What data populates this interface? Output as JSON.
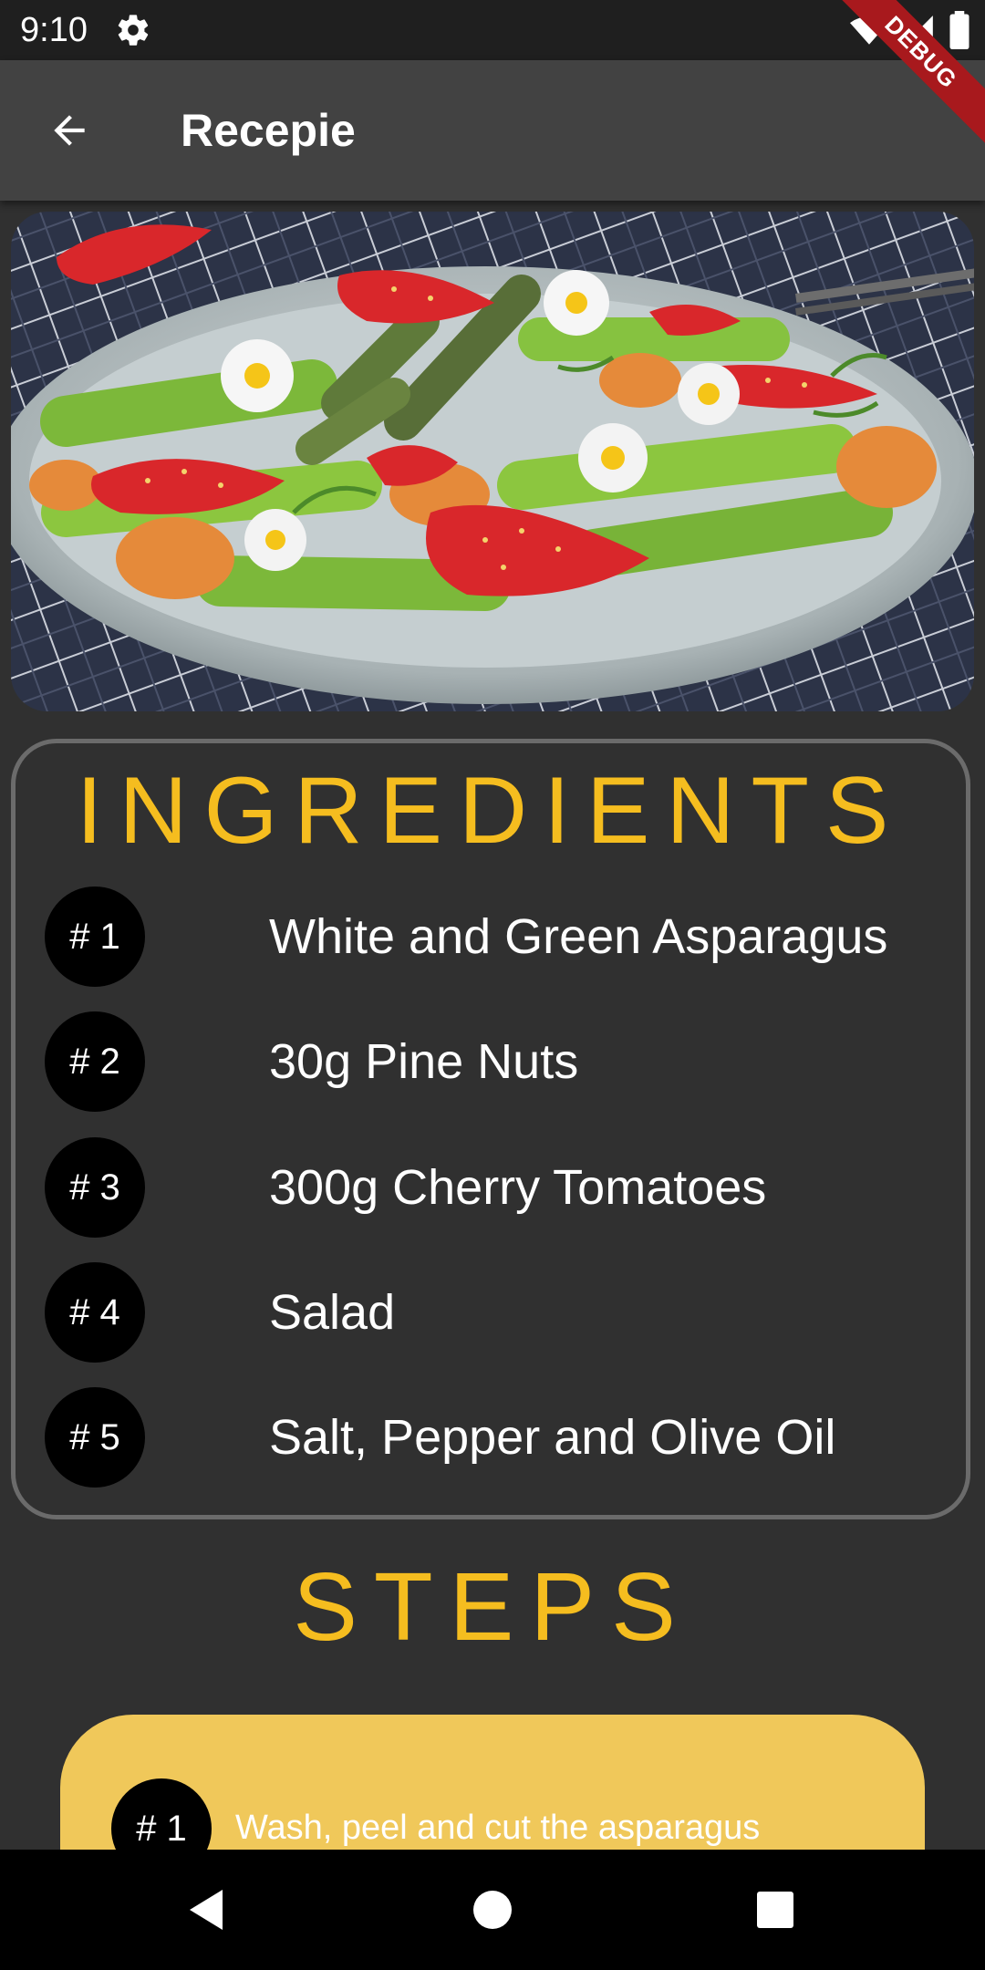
{
  "status_bar": {
    "time": "9:10",
    "icons": [
      "settings-icon",
      "wifi-icon",
      "signal-icon",
      "battery-icon"
    ]
  },
  "debug_banner": "DEBUG",
  "app_bar": {
    "title": "Recepie",
    "back_icon": "arrow-back-icon"
  },
  "ingredients": {
    "title": "INGREDIENTS",
    "items": [
      {
        "num": "# 1",
        "text": "White and Green Asparagus"
      },
      {
        "num": "# 2",
        "text": "30g Pine Nuts"
      },
      {
        "num": "# 3",
        "text": "300g Cherry Tomatoes"
      },
      {
        "num": "# 4",
        "text": "Salad"
      },
      {
        "num": "# 5",
        "text": "Salt, Pepper and Olive Oil"
      }
    ]
  },
  "steps": {
    "title": "STEPS",
    "items": [
      {
        "num": "# 1",
        "text": "Wash, peel and cut the asparagus"
      }
    ]
  },
  "nav_bar": {
    "icons": [
      "back-triangle-icon",
      "home-circle-icon",
      "recents-square-icon"
    ]
  },
  "colors": {
    "accent": "#f5bd1f",
    "background": "#303030",
    "app_bar": "#424242",
    "step_card": "#f0c85a",
    "debug": "#a8191d"
  }
}
